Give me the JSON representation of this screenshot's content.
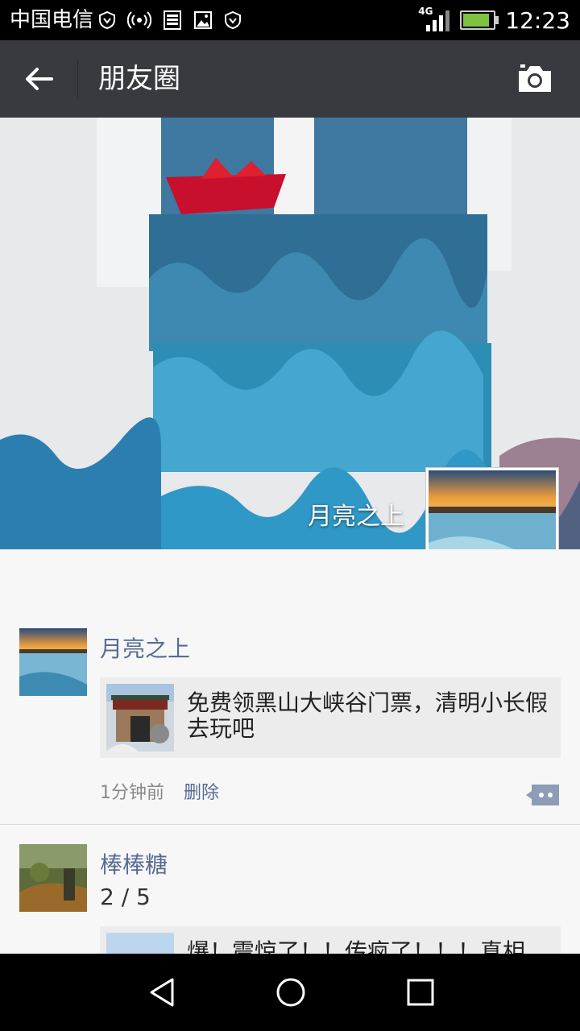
{
  "status_bar": {
    "carrier": "中国电信",
    "network": "4G",
    "time": "12:23",
    "icons": [
      "shield-icon",
      "hotspot-icon",
      "storage-icon",
      "image-icon",
      "shield-icon"
    ]
  },
  "header": {
    "title": "朋友圈",
    "back_icon": "back-arrow-icon",
    "camera_icon": "camera-icon"
  },
  "cover": {
    "username": "月亮之上"
  },
  "posts": [
    {
      "author": "月亮之上",
      "link_text": "免费领黑山大峡谷门票，清明小长假去玩吧",
      "time": "1分钟前",
      "delete_label": "删除"
    },
    {
      "author": "棒棒糖",
      "counter": "2 / 5",
      "link_text_partial": "爆！震惊了！！传疯了！！！真相"
    }
  ],
  "colors": {
    "titlebar": "#393a3f",
    "name_link": "#576b95",
    "feed_bg": "#f7f7f7"
  }
}
